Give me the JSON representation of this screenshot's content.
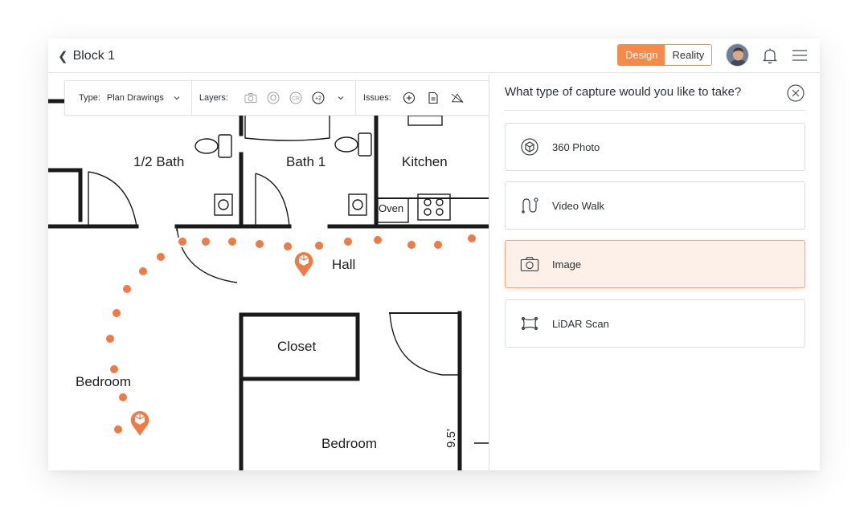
{
  "header": {
    "title": "Block 1",
    "toggle": {
      "design": "Design",
      "reality": "Reality",
      "active": "design"
    }
  },
  "planbar": {
    "type_label": "Type:",
    "type_value": "Plan Drawings",
    "layers_label": "Layers:",
    "layers_more": "+2",
    "layer_cr": "CR",
    "issues_label": "Issues:"
  },
  "floorplan": {
    "rooms": {
      "half_bath": "1/2 Bath",
      "bath1": "Bath 1",
      "kitchen": "Kitchen",
      "hall": "Hall",
      "closet": "Closet",
      "bedroom_left": "Bedroom",
      "bedroom": "Bedroom",
      "oven": "Oven",
      "dimension": "9.5'"
    }
  },
  "panel": {
    "title": "What type of capture would you like to take?",
    "options": [
      {
        "label": "360 Photo",
        "icon": "360-photo-icon",
        "selected": false
      },
      {
        "label": "Video Walk",
        "icon": "video-walk-icon",
        "selected": false
      },
      {
        "label": "Image",
        "icon": "camera-icon",
        "selected": true
      },
      {
        "label": "LiDAR Scan",
        "icon": "lidar-scan-icon",
        "selected": false
      }
    ]
  },
  "colors": {
    "accent": "#f58a4b",
    "marker": "#ef7a43",
    "selected_bg": "#fdf0e8"
  }
}
